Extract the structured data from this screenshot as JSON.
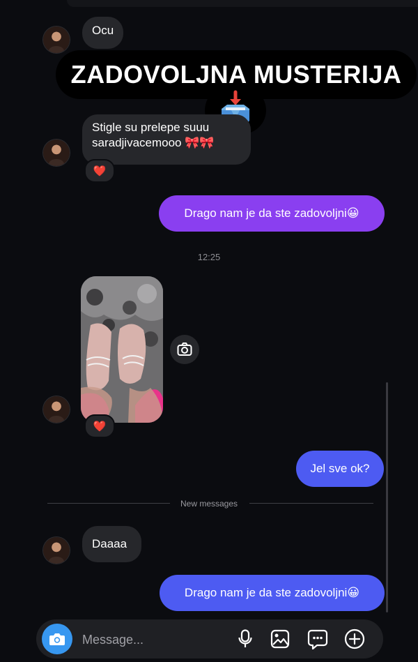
{
  "messages": {
    "in_1": "Ocu",
    "in_2_line1": "Stigle su prelepe suuu",
    "in_2_line2": "saradjivacemooo 🎀🎀",
    "out_1": "Drago nam je da ste zadovoljni😀",
    "timestamp": "12:25",
    "out_2": "Jel sve ok?",
    "new_messages": "New messages",
    "in_3": "Daaaa",
    "out_3": "Drago nam je da ste zadovoljni😀"
  },
  "overlay": {
    "banner_text": "ZADOVOLJNA MUSTERIJA",
    "banner_icon": "inbox-tray-icon"
  },
  "reactions": {
    "heart": "❤️"
  },
  "composer": {
    "placeholder": "Message..."
  },
  "colors": {
    "background": "#0b0c10",
    "incoming_bubble": "#26272b",
    "outgoing_purple": "#8a3ff0",
    "outgoing_blue": "#4d5bf2",
    "accent": "#3797f0"
  }
}
